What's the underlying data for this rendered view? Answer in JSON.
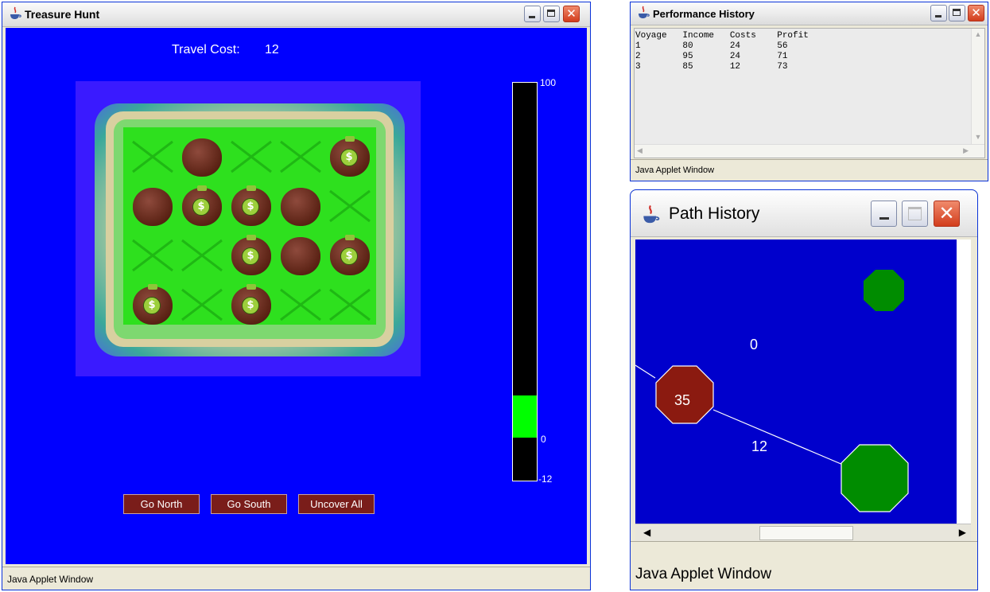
{
  "treasure": {
    "title": "Treasure Hunt",
    "travel_cost_label": "Travel Cost:",
    "travel_cost_value": "12",
    "meter": {
      "max_label": "100",
      "zero_label": "0",
      "min_label": "-12",
      "max": 100,
      "min": -12,
      "value": 12
    },
    "buttons": {
      "north": "Go North",
      "south": "Go South",
      "uncover": "Uncover All"
    },
    "status": "Java Applet Window",
    "grid": [
      [
        "empty",
        "rock",
        "empty",
        "empty",
        "money"
      ],
      [
        "rock",
        "money",
        "money",
        "rock",
        "empty"
      ],
      [
        "empty",
        "empty",
        "money",
        "rock",
        "money"
      ],
      [
        "money",
        "empty",
        "money",
        "empty",
        "empty"
      ]
    ],
    "coin_symbol": "$"
  },
  "performance": {
    "title": "Performance History",
    "headers": [
      "Voyage",
      "Income",
      "Costs",
      "Profit"
    ],
    "rows": [
      [
        "1",
        "80",
        "24",
        "56"
      ],
      [
        "2",
        "95",
        "24",
        "71"
      ],
      [
        "3",
        "85",
        "12",
        "73"
      ]
    ],
    "status": "Java Applet Window"
  },
  "path": {
    "title": "Path History",
    "label_top": "0",
    "node_value": "35",
    "edge_label": "12",
    "status": "Java Applet Window"
  },
  "colors": {
    "applet_bg": "#0000ff",
    "meter_fill": "#00ff00",
    "node_brown": "#8b1a10",
    "node_green": "#008c00",
    "path_bg": "#0000cc"
  }
}
